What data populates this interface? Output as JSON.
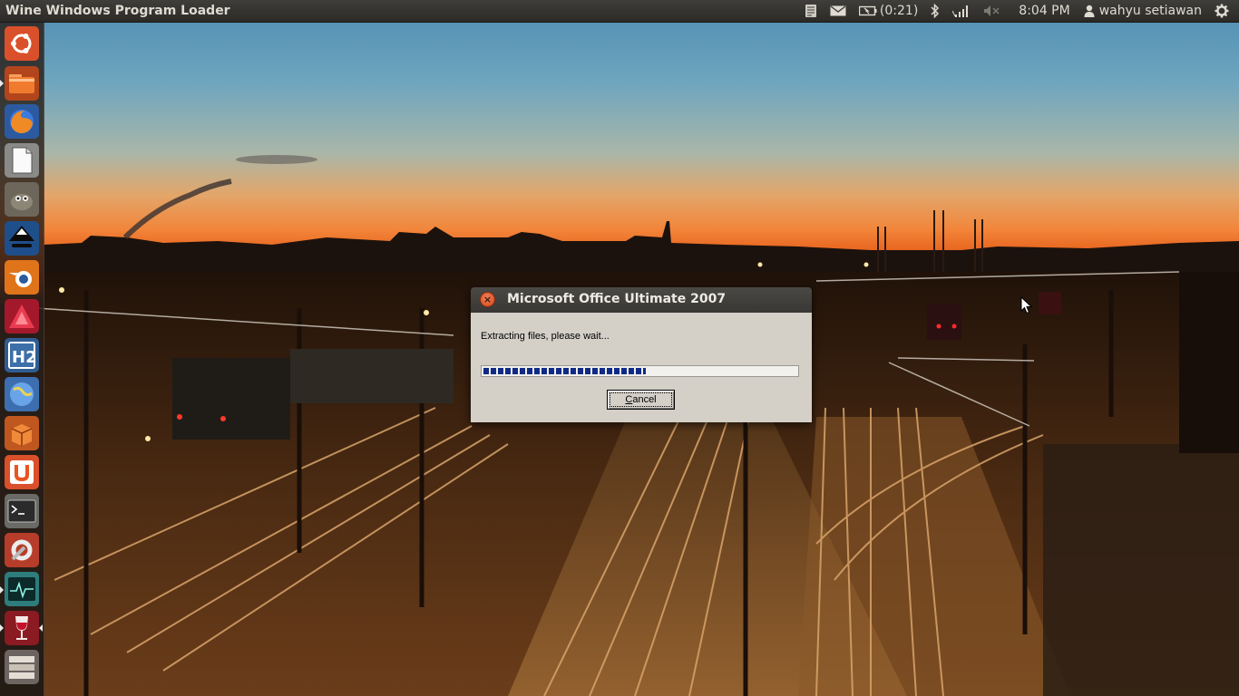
{
  "top_panel": {
    "app_title": "Wine Windows Program Loader",
    "battery_text": "(0:21)",
    "clock": "8:04 PM",
    "user_name": "wahyu setiawan",
    "indicators": [
      "keyboard-indicator-icon",
      "messaging-icon",
      "battery-icon",
      "bluetooth-icon",
      "network-signal-icon",
      "volume-muted-icon",
      "session-gear-icon"
    ]
  },
  "launcher": {
    "items": [
      {
        "name": "dash-home",
        "icon": "ubuntu-logo-icon"
      },
      {
        "name": "files",
        "icon": "folder-icon"
      },
      {
        "name": "firefox",
        "icon": "firefox-icon"
      },
      {
        "name": "libreoffice",
        "icon": "document-icon"
      },
      {
        "name": "gimp",
        "icon": "gimp-icon"
      },
      {
        "name": "inkscape",
        "icon": "inkscape-icon"
      },
      {
        "name": "blender",
        "icon": "blender-icon"
      },
      {
        "name": "app-red-triangle",
        "icon": "red-triangle-icon"
      },
      {
        "name": "h2-app",
        "icon": "h2-icon"
      },
      {
        "name": "app-globe",
        "icon": "globe-icon"
      },
      {
        "name": "app-box",
        "icon": "box-icon"
      },
      {
        "name": "ubuntu-software",
        "icon": "software-center-icon"
      },
      {
        "name": "terminal",
        "icon": "terminal-icon"
      },
      {
        "name": "system-settings",
        "icon": "settings-icon"
      },
      {
        "name": "system-monitor",
        "icon": "system-monitor-icon"
      },
      {
        "name": "wine",
        "icon": "wine-glass-icon"
      },
      {
        "name": "workspace-switcher",
        "icon": "workspace-icon"
      }
    ]
  },
  "dialog": {
    "title": "Microsoft Office Ultimate 2007",
    "message": "Extracting files, please wait...",
    "progress_fraction": 0.52,
    "cancel_underlined": "C",
    "cancel_rest": "ancel",
    "close_glyph": "×"
  },
  "colors": {
    "panel": "#3c3b37",
    "dialog_face": "#d4d0c8",
    "progress_block": "#102a86",
    "close_button": "#df5a2c"
  }
}
